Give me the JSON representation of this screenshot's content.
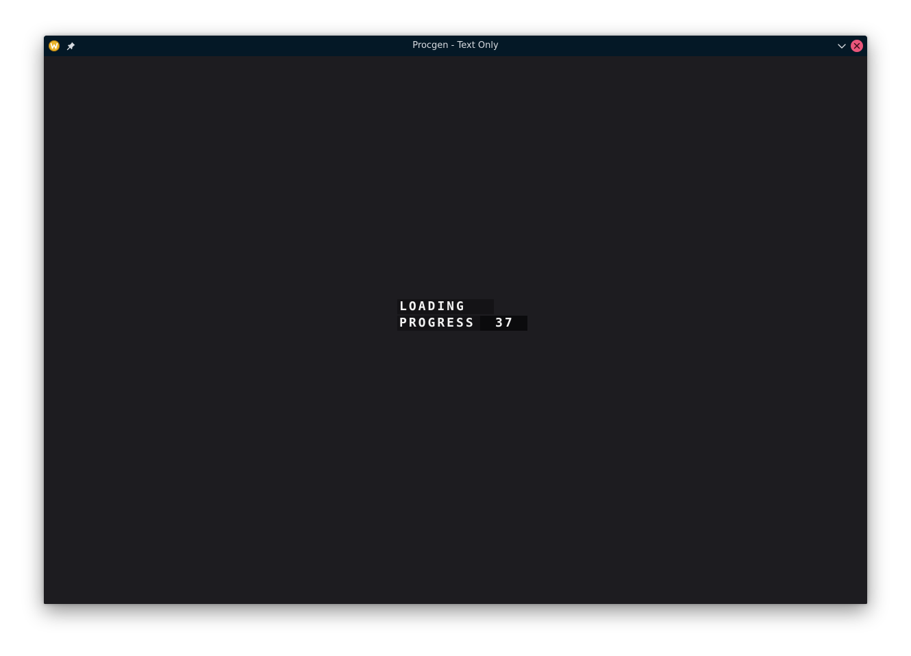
{
  "window": {
    "title": "Procgen - Text Only"
  },
  "titlebar": {
    "icons": {
      "app": "app-logo-icon",
      "pin": "pin-icon",
      "minimize": "chevron-down-icon",
      "close": "close-icon"
    },
    "colors": {
      "background": "#041826",
      "close_button": "#e9567b",
      "app_icon": "#e8b32a"
    }
  },
  "game": {
    "loading_label": "LOADING",
    "progress_label": "PROGRESS",
    "progress_value": "37",
    "colors": {
      "background": "#1d1c20",
      "text": "#f2f2f2"
    }
  }
}
